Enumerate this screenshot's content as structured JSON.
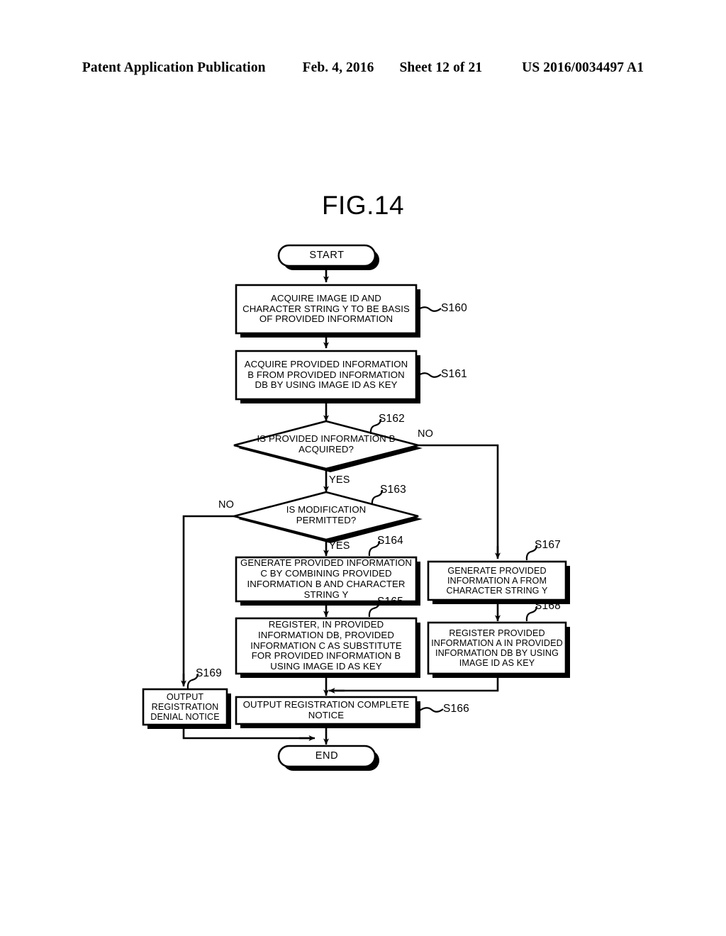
{
  "header": {
    "publication": "Patent Application Publication",
    "date": "Feb. 4, 2016",
    "sheet": "Sheet 12 of 21",
    "patent_number": "US 2016/0034497 A1"
  },
  "figure": {
    "title": "FIG.14"
  },
  "flowchart": {
    "nodes": {
      "start": {
        "label": "START",
        "shape": "terminal"
      },
      "s160": {
        "step": "S160",
        "shape": "process",
        "text": "ACQUIRE IMAGE ID AND CHARACTER STRING Y TO BE BASIS OF PROVIDED INFORMATION"
      },
      "s161": {
        "step": "S161",
        "shape": "process",
        "text": "ACQUIRE PROVIDED INFORMATION B FROM PROVIDED INFORMATION DB BY USING IMAGE ID AS KEY"
      },
      "s162": {
        "step": "S162",
        "shape": "decision",
        "text": "IS PROVIDED INFORMATION B ACQUIRED?"
      },
      "s163": {
        "step": "S163",
        "shape": "decision",
        "text": "IS MODIFICATION PERMITTED?"
      },
      "s164": {
        "step": "S164",
        "shape": "process",
        "text": "GENERATE PROVIDED INFORMATION C BY COMBINING PROVIDED INFORMATION B AND CHARACTER STRING Y"
      },
      "s165": {
        "step": "S165",
        "shape": "process",
        "text": "REGISTER, IN PROVIDED INFORMATION DB, PROVIDED INFORMATION C AS SUBSTITUTE FOR PROVIDED INFORMATION B USING IMAGE ID AS KEY"
      },
      "s166": {
        "step": "S166",
        "shape": "process",
        "text": "OUTPUT REGISTRATION COMPLETE NOTICE"
      },
      "s167": {
        "step": "S167",
        "shape": "process",
        "text": "GENERATE PROVIDED INFORMATION A FROM CHARACTER STRING Y"
      },
      "s168": {
        "step": "S168",
        "shape": "process",
        "text": "REGISTER PROVIDED INFORMATION A IN PROVIDED INFORMATION DB BY USING IMAGE ID AS KEY"
      },
      "s169": {
        "step": "S169",
        "shape": "process",
        "text": "OUTPUT REGISTRATION DENIAL NOTICE"
      },
      "end": {
        "label": "END",
        "shape": "terminal"
      }
    },
    "edge_labels": {
      "s162_no": "NO",
      "s162_yes": "YES",
      "s163_no": "NO",
      "s163_yes": "YES"
    },
    "colors": {
      "stroke": "#000000",
      "fill": "#ffffff",
      "shadow": "#000000"
    }
  }
}
